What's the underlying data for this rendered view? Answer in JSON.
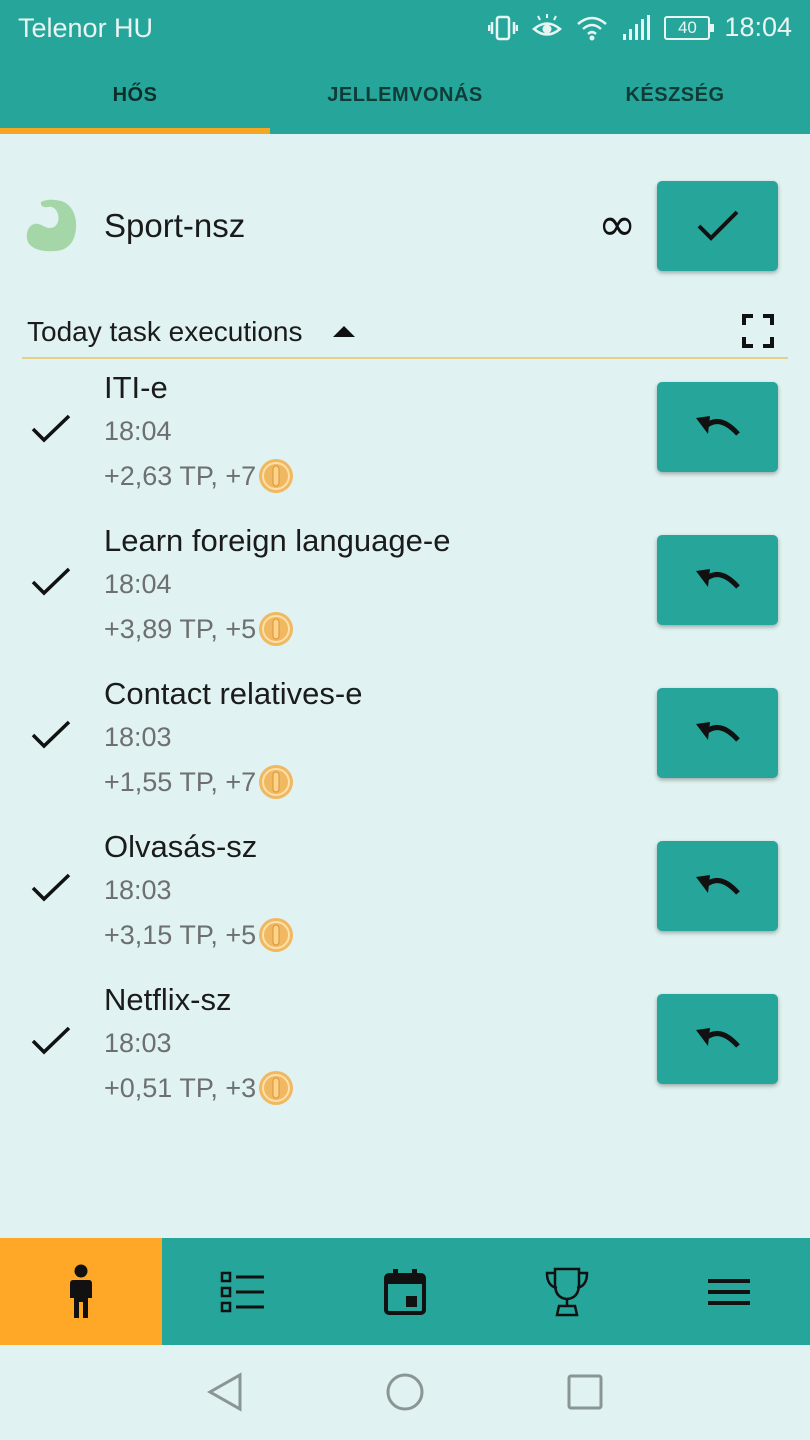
{
  "status_bar": {
    "carrier": "Telenor HU",
    "battery": "40",
    "time": "18:04"
  },
  "tabs": [
    {
      "label": "HŐS",
      "active": true
    },
    {
      "label": "JELLEMVONÁS",
      "active": false
    },
    {
      "label": "KÉSZSÉG",
      "active": false
    }
  ],
  "habit": {
    "title": "Sport-nsz",
    "repeat_symbol": "∞",
    "icon": "flexed-arm-icon"
  },
  "section": {
    "title": "Today task executions"
  },
  "executions": [
    {
      "name": "ITI-e",
      "time": "18:04",
      "reward": "+2,63 TP, +7"
    },
    {
      "name": "Learn foreign language-e",
      "time": "18:04",
      "reward": "+3,89 TP, +5"
    },
    {
      "name": "Contact relatives-e",
      "time": "18:03",
      "reward": "+1,55 TP, +7"
    },
    {
      "name": "Olvasás-sz",
      "time": "18:03",
      "reward": "+3,15 TP, +5"
    },
    {
      "name": "Netflix-sz",
      "time": "18:03",
      "reward": "+0,51 TP, +3"
    }
  ],
  "bottom_nav": [
    {
      "icon": "hero-person-icon",
      "active": true
    },
    {
      "icon": "task-list-icon",
      "active": false
    },
    {
      "icon": "calendar-icon",
      "active": false
    },
    {
      "icon": "trophy-icon",
      "active": false
    },
    {
      "icon": "menu-icon",
      "active": false
    }
  ],
  "colors": {
    "primary": "#26a69a",
    "accent": "#ffa726",
    "background": "#e0f2f1",
    "coin": "#f0b860"
  }
}
